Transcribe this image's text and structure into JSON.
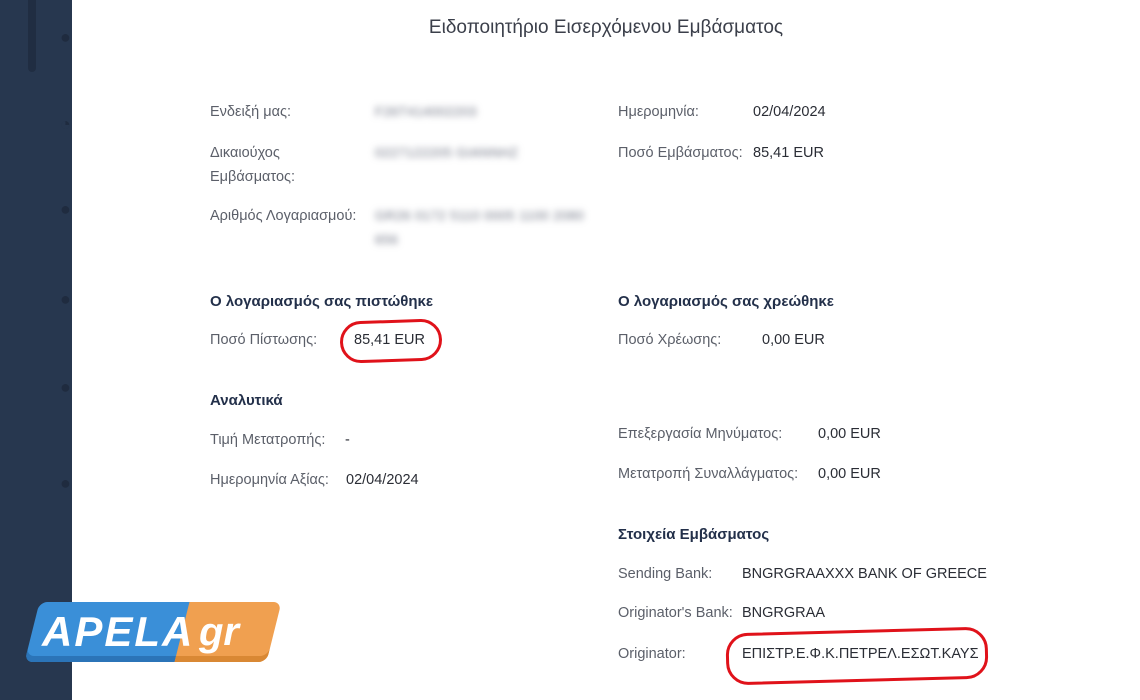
{
  "dialog": {
    "title": "Ειδοποιητήριο Εισερχόμενου Εμβάσματος"
  },
  "header_info": {
    "reference_label": "Ενδειξή μας:",
    "reference_value": "F26T414002203",
    "beneficiary_label": "Δικαιούχος Εμβάσματος:",
    "beneficiary_label_line1": "Δικαιούχος",
    "beneficiary_label_line2": "Εμβάσματος:",
    "beneficiary_value": "0227122205 GIANNHZ",
    "account_label": "Αριθμός Λογαριασμού:",
    "account_value_line1": "GR26 0172 5110 0005 1100 2080",
    "account_value_line2": "656",
    "date_label": "Ημερομηνία:",
    "date_value": "02/04/2024",
    "amount_label": "Ποσό Εμβάσματος:",
    "amount_value": "85,41 EUR"
  },
  "credited": {
    "heading": "Ο λογαριασμός σας πιστώθηκε",
    "label": "Ποσό Πίστωσης:",
    "value": "85,41 EUR"
  },
  "debited": {
    "heading": "Ο λογαριασμός σας χρεώθηκε",
    "label": "Ποσό Χρέωσης:",
    "value": "0,00 EUR"
  },
  "details": {
    "heading": "Αναλυτικά",
    "conversion_rate_label": "Τιμή Μετατροπής:",
    "conversion_rate_value": "-",
    "value_date_label": "Ημερομηνία Αξίας:",
    "value_date_value": "02/04/2024",
    "processing_label": "Επεξεργασία Μηνύματος:",
    "processing_value": "0,00 EUR",
    "fx_label": "Μετατροπή Συναλλάγματος:",
    "fx_value": "0,00 EUR"
  },
  "remittance": {
    "heading": "Στοιχεία Εμβάσματος",
    "sending_bank_label": "Sending Bank:",
    "sending_bank_value": "BNGRGRAAXXX BANK OF GREECE",
    "originator_bank_label": "Originator's Bank:",
    "originator_bank_value": "BNGRGRAA",
    "originator_label": "Originator:",
    "originator_value": "ΕΠΙΣΤΡ.Ε.Φ.Κ.ΠΕΤΡΕΛ.ΕΣΩΤ.ΚΑΥΣ"
  },
  "watermark": {
    "part1": "APELA",
    "part2": "gr",
    "blue": "#3a8fd8",
    "orange": "#f0a050"
  },
  "colors": {
    "highlight_circle": "#e0121a",
    "sidebar_bg": "#27374f"
  }
}
